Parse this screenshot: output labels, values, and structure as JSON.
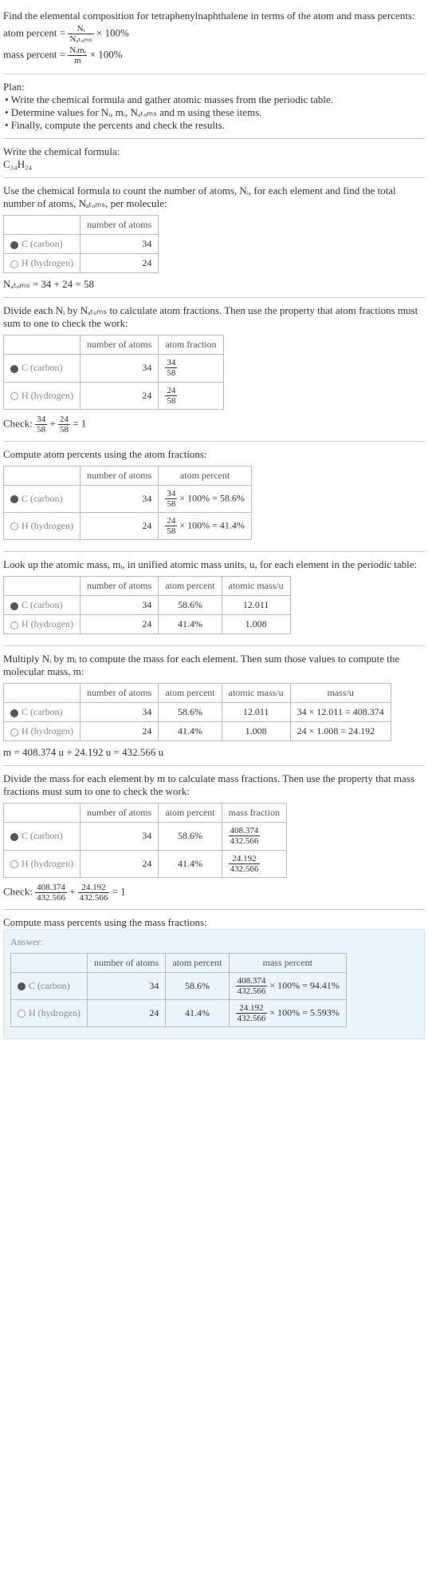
{
  "intro": {
    "line1": "Find the elemental composition for tetraphenylnaphthalene in terms of the atom and mass percents:",
    "atom_percent_label": "atom percent =",
    "atom_percent_frac_num": "Nᵢ",
    "atom_percent_frac_den": "Nₐₜₒₘₛ",
    "times100": "× 100%",
    "mass_percent_label": "mass percent =",
    "mass_percent_frac_num": "Nᵢmᵢ",
    "mass_percent_frac_den": "m"
  },
  "plan": {
    "title": "Plan:",
    "b1": "• Write the chemical formula and gather atomic masses from the periodic table.",
    "b2": "• Determine values for Nᵢ, mᵢ, Nₐₜₒₘₛ and m using these items.",
    "b3": "• Finally, compute the percents and check the results."
  },
  "step1": {
    "title": "Write the chemical formula:",
    "formula": "C₃₄H₂₄"
  },
  "step2": {
    "text": "Use the chemical formula to count the number of atoms, Nᵢ, for each element and find the total number of atoms, Nₐₜₒₘₛ, per molecule:",
    "h_atoms": "number of atoms",
    "rowC_label": "C (carbon)",
    "rowC_atoms": "34",
    "rowH_label": "H (hydrogen)",
    "rowH_atoms": "24",
    "sum": "Nₐₜₒₘₛ = 34 + 24 = 58"
  },
  "step3": {
    "text": "Divide each Nᵢ by Nₐₜₒₘₛ to calculate atom fractions. Then use the property that atom fractions must sum to one to check the work:",
    "h_atoms": "number of atoms",
    "h_frac": "atom fraction",
    "rowC_atoms": "34",
    "rowC_frac_num": "34",
    "rowC_frac_den": "58",
    "rowH_atoms": "24",
    "rowH_frac_num": "24",
    "rowH_frac_den": "58",
    "check_label": "Check:",
    "check_eq": "= 1"
  },
  "step4": {
    "text": "Compute atom percents using the atom fractions:",
    "h_atoms": "number of atoms",
    "h_pct": "atom percent",
    "rowC_atoms": "34",
    "rowC_num": "34",
    "rowC_den": "58",
    "rowC_rest": "× 100% = 58.6%",
    "rowH_atoms": "24",
    "rowH_num": "24",
    "rowH_den": "58",
    "rowH_rest": "× 100% = 41.4%"
  },
  "step5": {
    "text": "Look up the atomic mass, mᵢ, in unified atomic mass units, u, for each element in the periodic table:",
    "h_atoms": "number of atoms",
    "h_pct": "atom percent",
    "h_mass": "atomic mass/u",
    "rowC_atoms": "34",
    "rowC_pct": "58.6%",
    "rowC_mass": "12.011",
    "rowH_atoms": "24",
    "rowH_pct": "41.4%",
    "rowH_mass": "1.008"
  },
  "step6": {
    "text": "Multiply Nᵢ by mᵢ to compute the mass for each element. Then sum those values to compute the molecular mass, m:",
    "h_atoms": "number of atoms",
    "h_pct": "atom percent",
    "h_amass": "atomic mass/u",
    "h_mu": "mass/u",
    "rowC_atoms": "34",
    "rowC_pct": "58.6%",
    "rowC_amass": "12.011",
    "rowC_mu": "34 × 12.011 = 408.374",
    "rowH_atoms": "24",
    "rowH_pct": "41.4%",
    "rowH_amass": "1.008",
    "rowH_mu": "24 × 1.008 = 24.192",
    "sum": "m = 408.374 u + 24.192 u = 432.566 u"
  },
  "step7": {
    "text": "Divide the mass for each element by m to calculate mass fractions. Then use the property that mass fractions must sum to one to check the work:",
    "h_atoms": "number of atoms",
    "h_pct": "atom percent",
    "h_mf": "mass fraction",
    "rowC_atoms": "34",
    "rowC_pct": "58.6%",
    "rowC_num": "408.374",
    "rowC_den": "432.566",
    "rowH_atoms": "24",
    "rowH_pct": "41.4%",
    "rowH_num": "24.192",
    "rowH_den": "432.566",
    "check_label": "Check:",
    "c1n": "408.374",
    "c1d": "432.566",
    "c2n": "24.192",
    "c2d": "432.566",
    "check_eq": "= 1"
  },
  "step8": {
    "text": "Compute mass percents using the mass fractions:"
  },
  "answer": {
    "label": "Answer:",
    "h_atoms": "number of atoms",
    "h_pct": "atom percent",
    "h_mp": "mass percent",
    "rowC_atoms": "34",
    "rowC_pct": "58.6%",
    "rowC_num": "408.374",
    "rowC_den": "432.566",
    "rowC_rest": "× 100% = 94.41%",
    "rowH_atoms": "24",
    "rowH_pct": "41.4%",
    "rowH_num": "24.192",
    "rowH_den": "432.566",
    "rowH_rest": "× 100% = 5.593%"
  },
  "labels": {
    "C": "C (carbon)",
    "H": "H (hydrogen)",
    "plus": " + "
  }
}
